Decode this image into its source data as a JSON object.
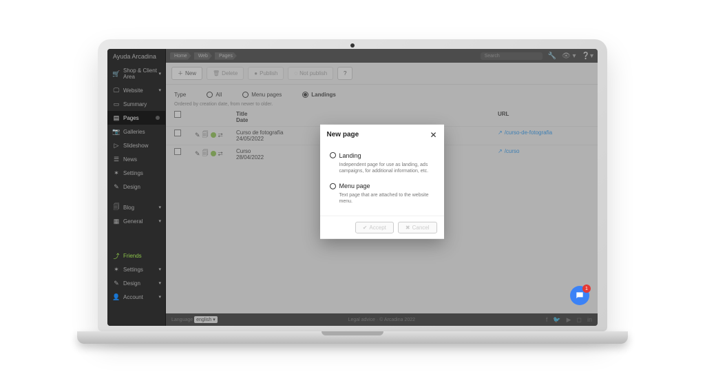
{
  "sidebar": {
    "brand": "Ayuda Arcadina",
    "shop": "Shop & Client Area",
    "groups": {
      "website": "Website",
      "items": [
        {
          "icon": "▭",
          "label": "Summary"
        },
        {
          "icon": "▤",
          "label": "Pages"
        },
        {
          "icon": "▦",
          "label": "Galleries"
        },
        {
          "icon": "▷",
          "label": "Slideshow"
        },
        {
          "icon": "☰",
          "label": "News"
        },
        {
          "icon": "✶",
          "label": "Settings"
        },
        {
          "icon": "✎",
          "label": "Design"
        }
      ],
      "blog": "Blog",
      "general": "General",
      "friends": "Friends",
      "settings2": "Settings",
      "design2": "Design",
      "account": "Account"
    }
  },
  "breadcrumb": [
    "Home",
    "Web",
    "Pages"
  ],
  "search": {
    "placeholder": "Search"
  },
  "toolbar": {
    "new": "New",
    "delete": "Delete",
    "publish": "Publish",
    "notpublish": "Not publish"
  },
  "filters": {
    "label": "Type",
    "all": "All",
    "menu": "Menu pages",
    "landings": "Landings"
  },
  "sort_note": "Ordered by creation date, from newer to older.",
  "headers": {
    "title": "Title\nDate",
    "t1": "Title",
    "t2": "Date",
    "url": "URL"
  },
  "rows": [
    {
      "title": "Curso de fotografía",
      "date": "24/05/2022",
      "url": "/curso-de-fotografia"
    },
    {
      "title": "Curso",
      "date": "28/04/2022",
      "url": "/curso"
    }
  ],
  "modal": {
    "title": "New page",
    "opt1": {
      "label": "Landing",
      "desc": "Independent page for use as landing, ads campaigns, for additional information, etc."
    },
    "opt2": {
      "label": "Menu page",
      "desc": "Text page that are attached to the website menu."
    },
    "accept": "Accept",
    "cancel": "Cancel"
  },
  "footer": {
    "lang_label": "Language",
    "lang": "english",
    "legal": "Legal advice",
    "copy": "© Arcadina 2022"
  },
  "chat": {
    "badge": "1"
  }
}
